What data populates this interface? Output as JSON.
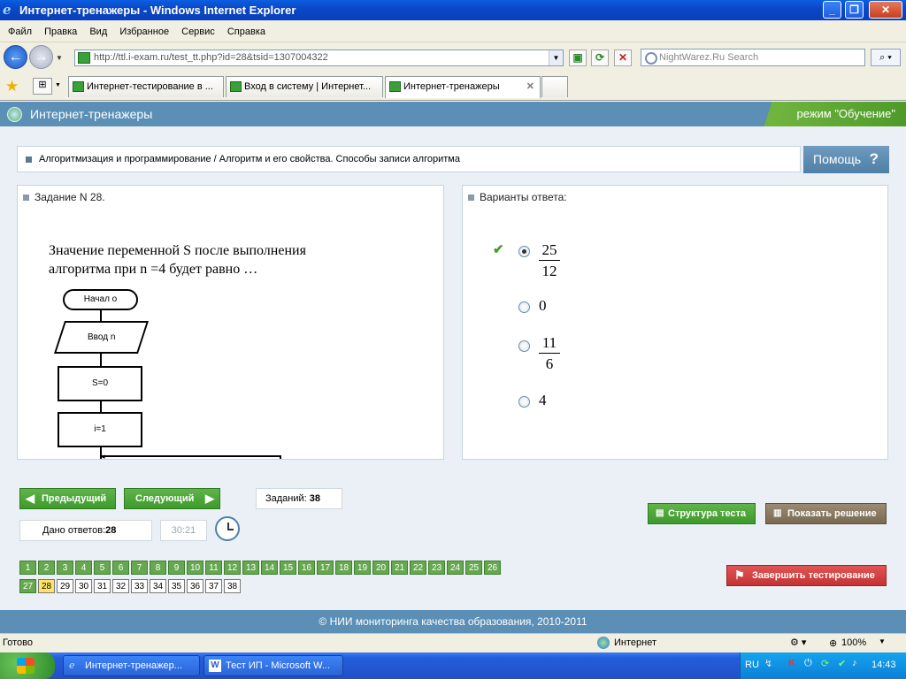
{
  "window": {
    "title": "Интернет-тренажеры - Windows Internet Explorer"
  },
  "menu": [
    "Файл",
    "Правка",
    "Вид",
    "Избранное",
    "Сервис",
    "Справка"
  ],
  "address": {
    "url": "http://ttl.i-exam.ru/test_tt.php?id=28&tsid=1307004322"
  },
  "search": {
    "placeholder": "NightWarez.Ru Search"
  },
  "tabs": [
    {
      "label": "Интернет-тестирование в ..."
    },
    {
      "label": "Вход в систему | Интернет..."
    },
    {
      "label": "Интернет-тренажеры"
    }
  ],
  "app": {
    "title": "Интернет-тренажеры",
    "mode": "режим \"Обучение\""
  },
  "topic": {
    "text": "Алгоритмизация и программирование / Алгоритм и его свойства. Способы записи алгоритма",
    "help_label": "Помощь"
  },
  "task": {
    "header": "Задание N 28.",
    "question_line1": "Значение переменной  S  после выполнения",
    "question_line2": "алгоритма при n =4 будет равно …",
    "flowchart": {
      "start": "Начал о",
      "input": "Ввод n",
      "s_init": "S=0",
      "i_init": "i=1"
    }
  },
  "answers": {
    "header": "Варианты ответа:",
    "options": [
      {
        "num": "25",
        "den": "12",
        "selected": true,
        "correct": true
      },
      {
        "text": "0",
        "selected": false
      },
      {
        "num": "11",
        "den": "6",
        "selected": false
      },
      {
        "text": "4",
        "selected": false
      }
    ]
  },
  "controls": {
    "prev": "Предыдущий",
    "next": "Следующий",
    "tasks_label": "Заданий:",
    "tasks_count": "38",
    "answered_label": "Дано ответов:",
    "answered_count": "28",
    "timer": "30:21",
    "structure": "Структура теста",
    "show_solution": "Показать решение",
    "finish": "Завершить тестирование"
  },
  "question_grid": {
    "row1": [
      "1",
      "2",
      "3",
      "4",
      "5",
      "6",
      "7",
      "8",
      "9",
      "10",
      "11",
      "12",
      "13",
      "14",
      "15",
      "16",
      "17",
      "18",
      "19",
      "20",
      "21",
      "22",
      "23",
      "24",
      "25",
      "26"
    ],
    "row2": [
      "27",
      "28",
      "29",
      "30",
      "31",
      "32",
      "33",
      "34",
      "35",
      "36",
      "37",
      "38"
    ],
    "current": "28"
  },
  "footer": {
    "text": "© НИИ мониторинга качества образования, 2010-2011"
  },
  "status": {
    "left": "Готово",
    "zone": "Интернет",
    "zoom": "100%"
  },
  "taskbar": {
    "items": [
      {
        "label": "Интернет-тренажер..."
      },
      {
        "label": "Тест ИП - Microsoft W..."
      }
    ],
    "lang": "RU",
    "clock": "14:43"
  }
}
